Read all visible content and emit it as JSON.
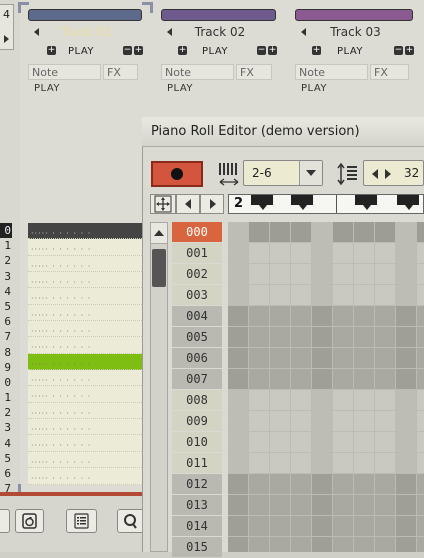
{
  "left_tab_label": "4",
  "left_row_numbers": [
    "0",
    "1",
    "2",
    "3",
    "4",
    "5",
    "6",
    "7",
    "8",
    "9",
    "0",
    "1",
    "2",
    "3",
    "4",
    "5",
    "6",
    "7"
  ],
  "tracks": [
    {
      "name": "Track 01",
      "color": "#5e6a8c",
      "play": "PLAY",
      "note": "Note",
      "fx": "FX",
      "play2": "PLAY",
      "name_color": "#e8dca0"
    },
    {
      "name": "Track 02",
      "color": "#6e5a8c",
      "play": "PLAY",
      "note": "Note",
      "fx": "FX",
      "play2": "PLAY",
      "name_color": "#333333"
    },
    {
      "name": "Track 03",
      "color": "#8a5a90",
      "play": "PLAY",
      "note": "Note",
      "fx": "FX",
      "play2": "PLAY",
      "name_color": "#333333"
    }
  ],
  "piano_roll": {
    "title": "Piano Roll Editor  (demo version)",
    "octave_range": "2-6",
    "steps_value": "32",
    "keys_label": "2",
    "step_labels": [
      "000",
      "001",
      "002",
      "003",
      "004",
      "005",
      "006",
      "007",
      "008",
      "009",
      "010",
      "011",
      "012",
      "013",
      "014",
      "015"
    ],
    "active_step": "000",
    "colors": {
      "record": "#d3553d",
      "active_step": "#d9653e",
      "highlight_row": "#7ebd12"
    }
  },
  "icons": [
    "triangle-left-icon",
    "plus-icon",
    "minus-icon",
    "record-icon",
    "piano-keys-icon",
    "height-arrows-icon",
    "nav-left-icon",
    "nav-right-icon",
    "scroll-up-icon",
    "loop-icon",
    "list-icon",
    "search-icon"
  ]
}
